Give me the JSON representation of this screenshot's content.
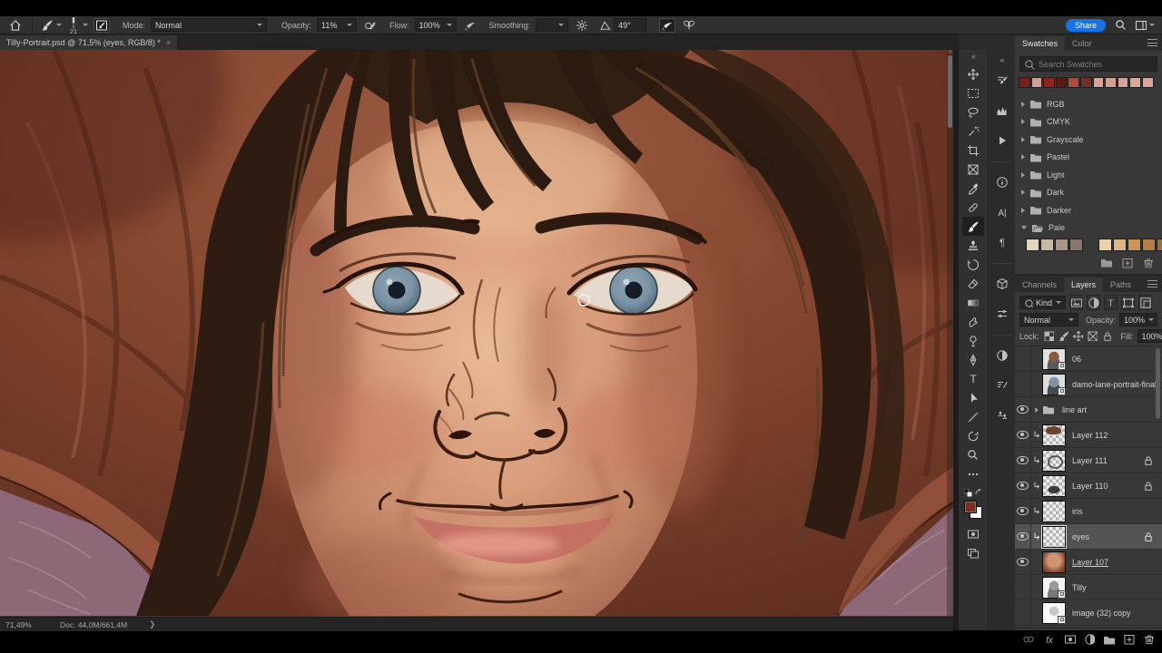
{
  "options_bar": {
    "brush_size": "21",
    "mode_label": "Mode:",
    "mode_value": "Normal",
    "opacity_label": "Opacity:",
    "opacity_value": "11%",
    "flow_label": "Flow:",
    "flow_value": "100%",
    "smoothing_label": "Smoothing:",
    "smoothing_value": "",
    "angle_value": "49°",
    "share_label": "Share"
  },
  "document_tab": {
    "title": "Tilly-Portrait.psd @ 71,5% (eyes, RGB/8) *",
    "close": "×"
  },
  "tools": [
    "move",
    "rectangular-marquee",
    "lasso",
    "object-selection",
    "crop",
    "frame",
    "eyedropper",
    "spot-healing",
    "brush",
    "clone-stamp",
    "history-brush",
    "eraser",
    "gradient",
    "smudge",
    "dodge",
    "pen",
    "type",
    "path-selection",
    "line",
    "rotate-view",
    "zoom",
    "edit-toolbar"
  ],
  "panel_strip_icons": [
    "brush-settings",
    "histogram",
    "actions-play",
    "info",
    "character",
    "paragraph",
    "3d",
    "adjustments",
    "masks",
    "brushes",
    "clone-source"
  ],
  "colors": {
    "foreground": "#7e2d1f",
    "background": "#ffffff",
    "accent_blue": "#1473e6"
  },
  "swatches_panel": {
    "tabs": [
      "Swatches",
      "Color"
    ],
    "search_placeholder": "Search Swatches",
    "recent_swatches": [
      "#7c1f1a",
      "#d79c92",
      "#8e241e",
      "#5f1713",
      "#b34a42",
      "#70302a",
      "#d8a396",
      "#d4a095",
      "#d7a399",
      "#daa79c",
      "#d8a59a"
    ],
    "groups": [
      {
        "name": "RGB"
      },
      {
        "name": "CMYK"
      },
      {
        "name": "Grayscale"
      },
      {
        "name": "Pastel"
      },
      {
        "name": "Light"
      },
      {
        "name": "Dark"
      },
      {
        "name": "Darker"
      },
      {
        "name": "Pale"
      }
    ],
    "pale_swatches": [
      "#e3d6bd",
      "#c5b7a1",
      "#a99786",
      "#897767",
      "gap",
      "#ecd0a6",
      "#ddb687",
      "#cc9459",
      "#b67d43",
      "#a06b34"
    ]
  },
  "layers_panel": {
    "tabs": [
      "Channels",
      "Layers",
      "Paths"
    ],
    "filter_value": "Kind",
    "blend_mode": "Normal",
    "opacity_label": "Opacity:",
    "opacity_value": "100%",
    "lock_label": "Lock:",
    "fill_label": "Fill:",
    "fill_value": "100%",
    "layers": [
      {
        "name": "06"
      },
      {
        "name": "damo-lane-portrait-final"
      },
      {
        "name": "line art"
      },
      {
        "name": "Layer 112"
      },
      {
        "name": "Layer 111"
      },
      {
        "name": "Layer 110"
      },
      {
        "name": "iris"
      },
      {
        "name": "eyes"
      },
      {
        "name": "Layer 107"
      },
      {
        "name": "Tilly"
      },
      {
        "name": "image (32) copy"
      }
    ]
  },
  "status_bar": {
    "zoom": "71,49%",
    "doc_info": "Doc: 44,0M/661,4M"
  }
}
